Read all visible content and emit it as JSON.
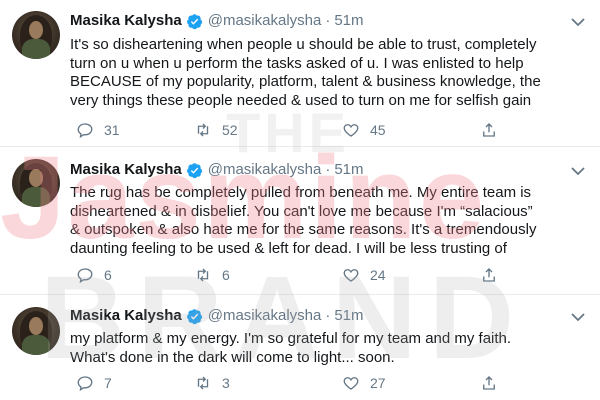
{
  "watermark": {
    "line1": "THE",
    "line2": "Jasmine",
    "line3": "BRAND"
  },
  "tweets": [
    {
      "name": "Masika Kalysha",
      "handle": "@masikakalysha",
      "separator": "·",
      "time": "51m",
      "lines": [
        "It's so disheartening when people u should be able to trust, completely",
        "turn on u when u perform the tasks asked of u. I was enlisted to help",
        "BECAUSE of my popularity, platform, talent & business knowledge, the",
        "very things these people needed & used to turn on me for selfish gain"
      ],
      "replies": "31",
      "retweets": "52",
      "likes": "45"
    },
    {
      "name": "Masika Kalysha",
      "handle": "@masikakalysha",
      "separator": "·",
      "time": "51m",
      "lines": [
        "The rug has be completely pulled from beneath me. My entire team is",
        "disheartened & in disbelief. You can't love me because I'm “salacious”",
        "& outspoken & also hate me for the same reasons. It's a tremendously",
        "daunting feeling to be used & left for dead. I will be less trusting of"
      ],
      "replies": "6",
      "retweets": "6",
      "likes": "24"
    },
    {
      "name": "Masika Kalysha",
      "handle": "@masikakalysha",
      "separator": "·",
      "time": "51m",
      "lines": [
        "my platform & my energy. I'm so grateful for my team and my faith.",
        "What's done in the dark will come to light... soon."
      ],
      "replies": "7",
      "retweets": "3",
      "likes": "27"
    }
  ],
  "icons": {
    "verified": "verified-badge-icon",
    "caret": "chevron-down-icon",
    "reply": "reply-icon",
    "retweet": "retweet-icon",
    "like": "heart-icon",
    "share": "share-icon"
  },
  "colors": {
    "text": "#14171a",
    "secondary": "#657786",
    "verified": "#1da1f2",
    "divider": "#e6ecf0"
  }
}
